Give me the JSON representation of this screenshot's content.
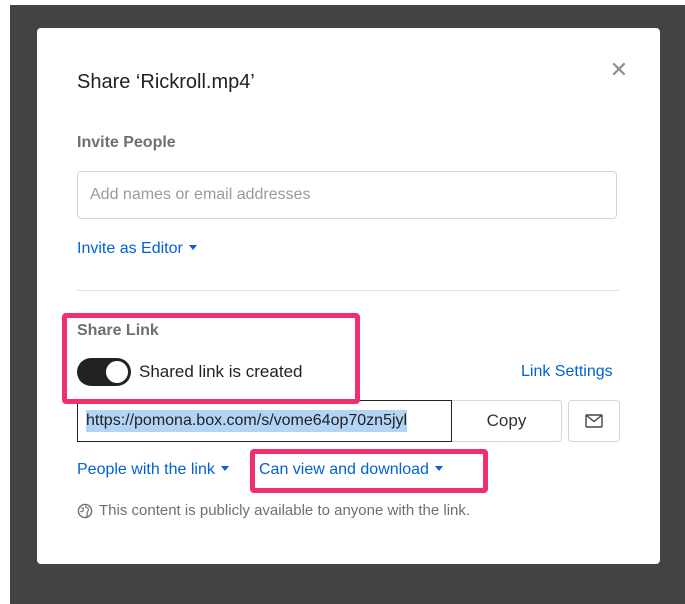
{
  "dialog": {
    "title": "Share ‘Rickroll.mp4’",
    "close_icon": "✕"
  },
  "invite": {
    "section_label": "Invite People",
    "input_placeholder": "Add names or email addresses",
    "input_value": "",
    "role_label": "Invite as Editor"
  },
  "share_link": {
    "section_label": "Share Link",
    "toggle_on": true,
    "toggle_label": "Shared link is created",
    "settings_label": "Link Settings",
    "url": "https://pomona.box.com/s/vome64op70zn5jyl",
    "copy_label": "Copy",
    "email_icon": "mail-icon",
    "access_label": "People with the link",
    "permission_label": "Can view and download",
    "public_note": "This content is publicly available to anyone with the link."
  },
  "highlights": [
    "share-link-toggle-area",
    "permission-dropdown"
  ],
  "colors": {
    "accent": "#0061d5",
    "highlight": "#f0306a",
    "backdrop": "#434343",
    "toggle_on": "#222222"
  }
}
